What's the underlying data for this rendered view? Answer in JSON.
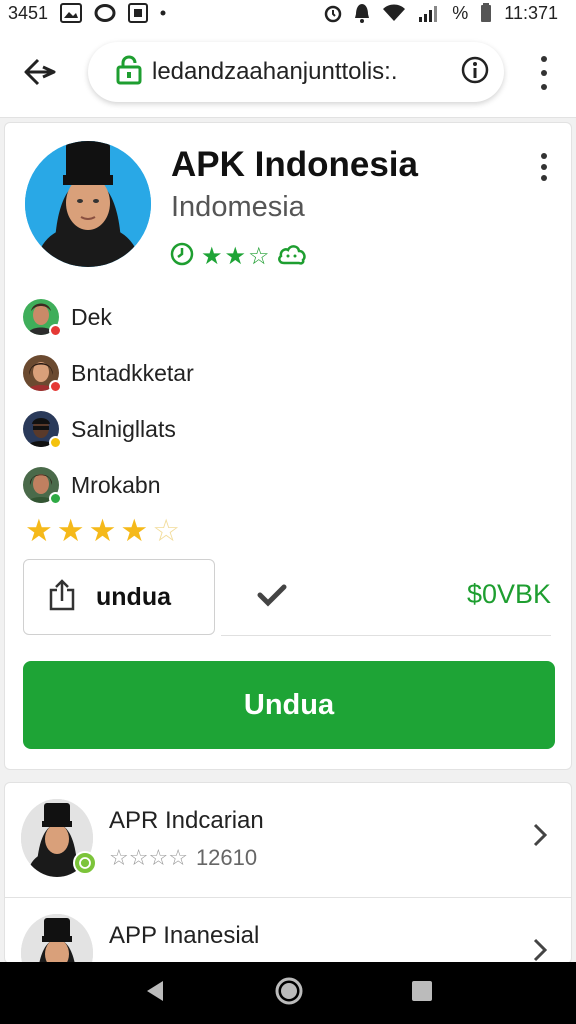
{
  "status_bar": {
    "time_left": "3451",
    "battery_text": "%",
    "time_right": "11:371"
  },
  "browser": {
    "url": "ledandzaahanjunttolis:."
  },
  "app": {
    "title": "APK Indonesia",
    "subtitle": "Indomesia",
    "rating_stars": 2,
    "rating_max": 3
  },
  "developers": [
    {
      "name": "Dek",
      "badge_color": "#e53935"
    },
    {
      "name": "Bntadkketar",
      "badge_color": "#e53935"
    },
    {
      "name": "Salnigllats",
      "badge_color": "#f4c20d"
    },
    {
      "name": "Mrokabn",
      "badge_color": "#2eaa44"
    }
  ],
  "review_rating": 4,
  "review_max": 5,
  "actions": {
    "share_label": "undua",
    "price": "$0VBK",
    "install_label": "Undua"
  },
  "related": [
    {
      "title": "APR Indcarian",
      "meta": "12610",
      "stars": 0
    },
    {
      "title": "APP Inanesial",
      "meta": "",
      "stars": 0
    }
  ],
  "colors": {
    "accent_green": "#1ea436",
    "star_yellow": "#f5b91a",
    "avatar_blue": "#29a8e6"
  }
}
